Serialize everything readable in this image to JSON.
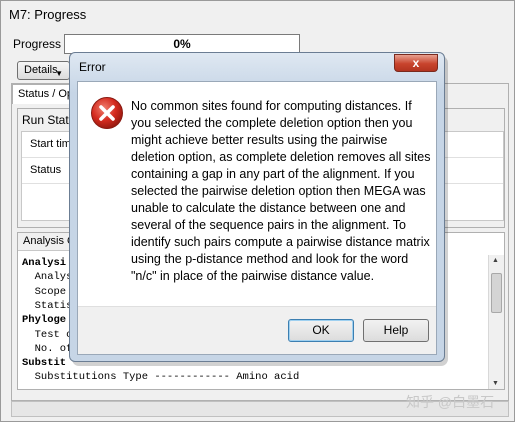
{
  "main_window": {
    "title": "M7: Progress",
    "progress_label": "Progress",
    "progress_value": "0%",
    "progress_fraction": 0,
    "details_button": "Details",
    "tab_label": "Status / Opt",
    "run_status_label": "Run Status",
    "run_rows": [
      "Start time",
      "Status"
    ],
    "analysis_label": "Analysis O",
    "analysis_lines": [
      {
        "text": "Analysi",
        "bold": true
      },
      {
        "text": "  Analys",
        "bold": false
      },
      {
        "text": "  Scope ",
        "bold": false
      },
      {
        "text": "  Statis",
        "bold": false
      },
      {
        "text": "Phyloge",
        "bold": true
      },
      {
        "text": "  Test o",
        "bold": false
      },
      {
        "text": "  No. of",
        "bold": false
      },
      {
        "text": "Substit",
        "bold": true
      },
      {
        "text": "  Substitutions Type ------------ Amino acid",
        "bold": false
      }
    ]
  },
  "dialog": {
    "title": "Error",
    "close_glyph": "x",
    "message": "No common sites found for computing distances. If you selected the complete deletion option then you might achieve better results using the pairwise deletion option, as complete deletion removes all sites containing a gap in any part of the alignment. If you selected the pairwise deletion option then MEGA was unable to calculate the distance between one and several of the sequence pairs in the alignment. To identify such pairs compute a pairwise distance matrix using the p-distance method and look for the word \"n/c\" in place of the pairwise distance value.",
    "buttons": {
      "ok": "OK",
      "help": "Help"
    },
    "icon": "error-icon"
  },
  "watermark": "知乎 @白墨石",
  "colors": {
    "close_red": "#c8432c",
    "error_icon_red": "#d42a1e",
    "dialog_frame": "#c6d5e6"
  }
}
